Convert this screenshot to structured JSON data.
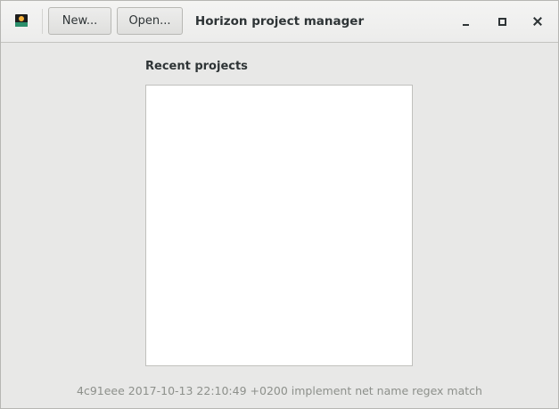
{
  "header": {
    "app_icon": "horizon-sunset-icon",
    "new_label": "New...",
    "open_label": "Open...",
    "title": "Horizon project manager",
    "window_controls": [
      "minimize-icon",
      "maximize-icon",
      "close-icon"
    ]
  },
  "main": {
    "recent_label": "Recent projects",
    "recent_items": []
  },
  "footer": {
    "version_text": "4c91eee 2017-10-13 22:10:49 +0200 implement net name regex match"
  },
  "colors": {
    "background": "#e8e8e7",
    "text": "#2e3436",
    "muted_text": "#8d908b",
    "icon_sun": "#f7b23b",
    "icon_ground": "#2b8f6b"
  }
}
